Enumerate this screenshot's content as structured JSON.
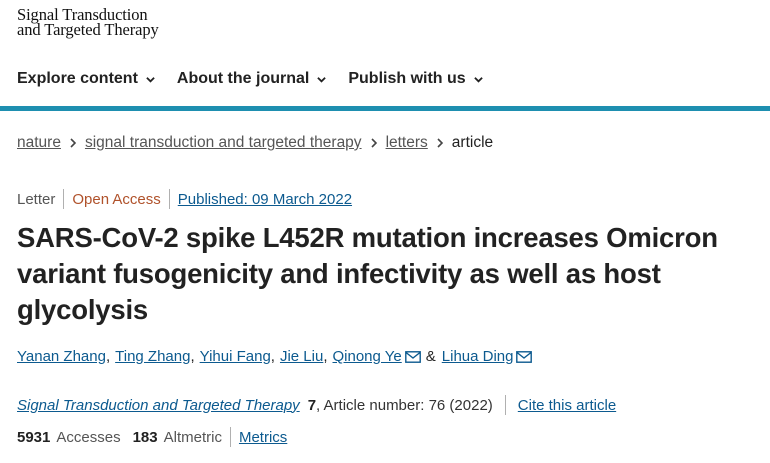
{
  "logo": {
    "line1": "Signal Transduction",
    "line2": "and Targeted Therapy"
  },
  "nav": [
    {
      "label": "Explore content",
      "icon": "chevron-down-icon"
    },
    {
      "label": "About the journal",
      "icon": "chevron-down-icon"
    },
    {
      "label": "Publish with us",
      "icon": "chevron-down-icon"
    }
  ],
  "colors": {
    "accent_bar": "#1e8fb0",
    "link": "#0c5a8f",
    "open_access": "#b0522b"
  },
  "breadcrumb": {
    "items": [
      "nature",
      "signal transduction and targeted therapy",
      "letters"
    ],
    "current": "article"
  },
  "meta": {
    "type": "Letter",
    "access": "Open Access",
    "published": "Published: 09 March 2022"
  },
  "title": "SARS-CoV-2 spike L452R mutation increases Omicron variant fusogenicity and infectivity as well as host glycolysis",
  "authors": [
    {
      "name": "Yanan Zhang"
    },
    {
      "name": "Ting Zhang"
    },
    {
      "name": "Yihui Fang"
    },
    {
      "name": "Jie Liu"
    },
    {
      "name": "Qinong Ye",
      "icon": "envelope-icon"
    },
    {
      "name": "Lihua Ding",
      "icon": "envelope-icon"
    }
  ],
  "authors_sep": ",",
  "authors_amp": "&",
  "journal": {
    "name": "Signal Transduction and Targeted Therapy",
    "volume": "7",
    "article_number": ", Article number: 76 (2022)",
    "cite_label": "Cite this article"
  },
  "metrics": {
    "accesses_count": "5931",
    "accesses_label": "Accesses",
    "altmetric_count": "183",
    "altmetric_label": "Altmetric",
    "metrics_link": "Metrics"
  }
}
